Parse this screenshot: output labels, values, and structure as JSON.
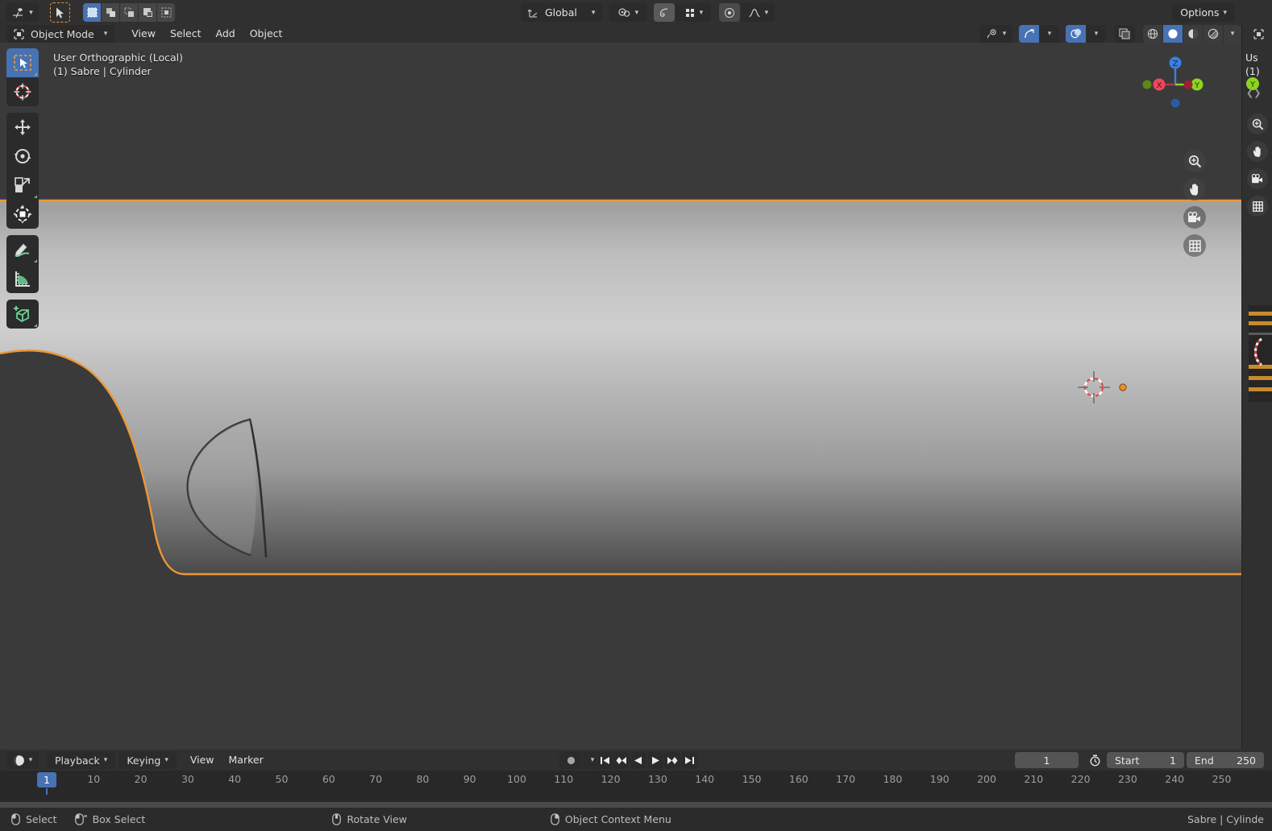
{
  "app": {
    "name": "Blender",
    "editor": "3D Viewport"
  },
  "tool_settings": {
    "transform_orientation": "Global",
    "snap_icon": "magnet-icon",
    "proportional_icon": "proportional-edit-icon",
    "falloff_icon": "smooth-falloff-icon",
    "options_label": "Options",
    "active_tool_icon": "tweak-cursor-icon",
    "select_modes": [
      "select-new-icon",
      "select-extend-icon",
      "select-subtract-icon",
      "select-invert-icon",
      "select-intersect-icon"
    ],
    "select_mode_active": 0,
    "editor_type_icon": "editor-type-icon"
  },
  "viewport_header": {
    "mode_icon": "object-mode-icon",
    "mode": "Object Mode",
    "menus": [
      "View",
      "Select",
      "Add",
      "Object"
    ],
    "right_icons": [
      "visibility-icon",
      "gizmo-icon",
      "overlays-icon",
      "xray-icon"
    ],
    "shading_modes": [
      "wireframe-icon",
      "solid-icon",
      "material-preview-icon",
      "rendered-icon"
    ],
    "shading_active": 1
  },
  "viewport": {
    "view_label": "User Orthographic (Local)",
    "object_label": "(1) Sabre | Cylinder",
    "selection_color": "#ed9636",
    "cursor_name": "3d-cursor",
    "origin_name": "object-origin",
    "gizmo_axes": [
      {
        "label": "Z",
        "color": "#3b7fe0"
      },
      {
        "label": "X",
        "color": "#f0475b"
      },
      {
        "label": "Y",
        "color": "#8dd423"
      }
    ],
    "nav_buttons": [
      "zoom-icon",
      "pan-icon",
      "camera-icon",
      "orthographic-toggle-icon"
    ]
  },
  "tools": [
    {
      "name": "tweak-select-box",
      "icon": "select-box-icon",
      "active": true
    },
    {
      "name": "cursor",
      "icon": "cursor-icon",
      "active": false
    },
    {
      "name": "move",
      "icon": "move-icon",
      "active": false
    },
    {
      "name": "rotate",
      "icon": "rotate-icon",
      "active": false
    },
    {
      "name": "scale",
      "icon": "scale-icon",
      "active": false
    },
    {
      "name": "transform",
      "icon": "transform-icon",
      "active": false
    },
    {
      "name": "annotate",
      "icon": "annotate-icon",
      "active": false
    },
    {
      "name": "measure",
      "icon": "measure-icon",
      "active": false
    },
    {
      "name": "add-cube",
      "icon": "add-cube-icon",
      "active": false
    }
  ],
  "timeline": {
    "editor_icon": "timeline-editor-icon",
    "menus": [
      "Playback",
      "Keying",
      "View",
      "Marker"
    ],
    "record_icon": "auto-keying-icon",
    "playback_buttons": [
      "jump-to-start-icon",
      "previous-keyframe-icon",
      "play-reverse-icon",
      "play-icon",
      "next-keyframe-icon",
      "jump-to-end-icon"
    ],
    "current_frame": "1",
    "use_preview_range_icon": "preview-range-icon",
    "start_label": "Start",
    "start_value": "1",
    "end_label": "End",
    "end_value": "250",
    "ruler_ticks": [
      "1",
      "10",
      "20",
      "30",
      "40",
      "50",
      "60",
      "70",
      "80",
      "90",
      "100",
      "110",
      "120",
      "130",
      "140",
      "150",
      "160",
      "170",
      "180",
      "190",
      "200",
      "210",
      "220",
      "230",
      "240",
      "250"
    ],
    "playhead_frame": "1"
  },
  "statusbar": {
    "items": [
      {
        "icon": "mouse-left-icon",
        "label": "Select"
      },
      {
        "icon": "mouse-drag-icon",
        "label": "Box Select"
      },
      {
        "icon": "mouse-middle-icon",
        "label": "Rotate View"
      },
      {
        "icon": "mouse-right-icon",
        "label": "Object Context Menu"
      }
    ],
    "right_text": "Sabre | Cylinde"
  },
  "side_panel": {
    "expand_icon": "region-toggle-icon",
    "view_label": "Us",
    "object_label": "(1)"
  }
}
